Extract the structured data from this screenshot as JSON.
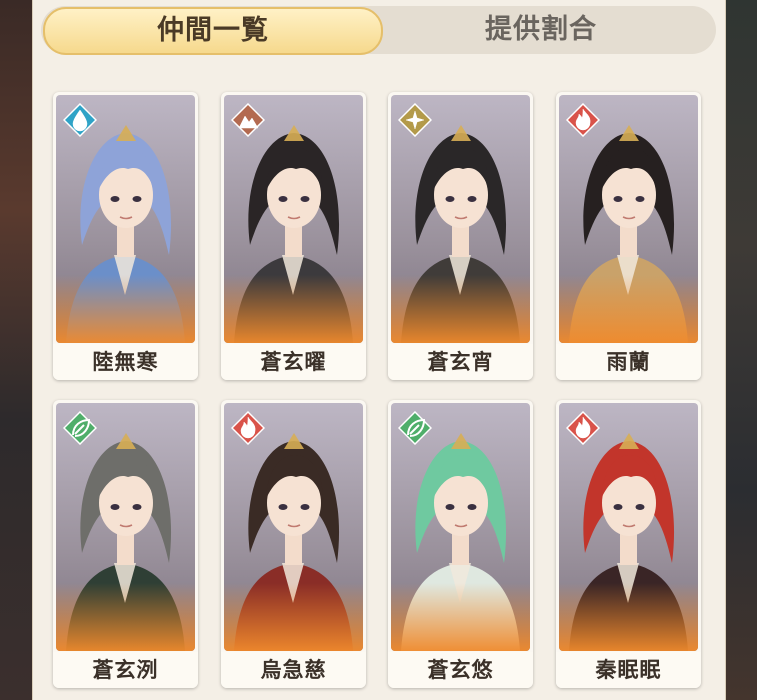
{
  "tabs": {
    "active_label": "仲間一覧",
    "inactive_label": "提供割合"
  },
  "characters": [
    {
      "name": "陸無寒",
      "element": "water-icon",
      "element_color": "#2fa3c7",
      "hair": "#8ea3d8",
      "outfit": "#6b8fc9"
    },
    {
      "name": "蒼玄曜",
      "element": "earth-icon",
      "element_color": "#b36a50",
      "hair": "#2a2526",
      "outfit": "#3c3a3d"
    },
    {
      "name": "蒼玄宵",
      "element": "light-icon",
      "element_color": "#b39a4a",
      "hair": "#2a2728",
      "outfit": "#403c39"
    },
    {
      "name": "雨蘭",
      "element": "fire-icon",
      "element_color": "#d9534a",
      "hair": "#262020",
      "outfit": "#c9a26a"
    },
    {
      "name": "蒼玄洌",
      "element": "wind-icon",
      "element_color": "#4fae6a",
      "hair": "#6e6e6a",
      "outfit": "#2f3f35"
    },
    {
      "name": "烏急慈",
      "element": "fire-icon",
      "element_color": "#d9534a",
      "hair": "#3a2b25",
      "outfit": "#8a2d27"
    },
    {
      "name": "蒼玄悠",
      "element": "wind-icon",
      "element_color": "#4fae6a",
      "hair": "#6fc9a0",
      "outfit": "#dfe8e0"
    },
    {
      "name": "秦眠眠",
      "element": "fire-icon",
      "element_color": "#d9534a",
      "hair": "#c2352b",
      "outfit": "#3a2526"
    }
  ]
}
